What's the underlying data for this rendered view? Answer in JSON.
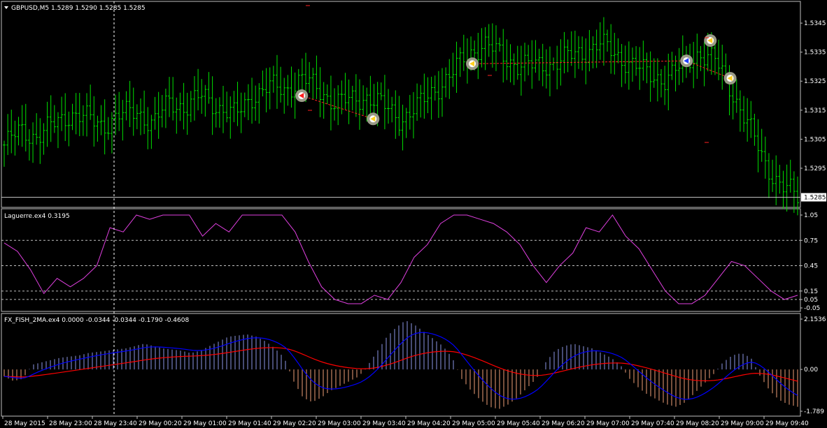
{
  "symbol_header": "GBPUSD,M5  1.5289 1.5290 1.5285 1.5285",
  "laguerre_header": "Laguerre.ex4 0.3195",
  "fisher_header": "FX_FISH_2MA.ex4 0.0000 -0.0344 -0.0344 -0.1790 -0.4608",
  "colors": {
    "background": "#000000",
    "candle": "#00e000",
    "laguerre": "#e040e0",
    "fish_pos": "#8c96e6",
    "fish_neg": "#f0a078",
    "fish_ma_fast": "#0000ff",
    "fish_ma_slow": "#ff0000",
    "grid": "#c0c0c0"
  },
  "chart_data": [
    {
      "type": "ohlc",
      "panel": "price",
      "y_axis_ticks": [
        "1.5345",
        "1.5335",
        "1.5325",
        "1.5315",
        "1.5305",
        "1.5295"
      ],
      "ylim": [
        1.5282,
        1.5352
      ],
      "current_price_label": "1.5285",
      "close_path": [
        1.5303,
        1.5308,
        1.5306,
        1.531,
        1.5314,
        1.5312,
        1.531,
        1.5313,
        1.5315,
        1.531,
        1.5318,
        1.5316,
        1.532,
        1.5316,
        1.5313,
        1.532,
        1.5323,
        1.5322,
        1.5326,
        1.5322,
        1.5318,
        1.5318,
        1.532,
        1.5316,
        1.5312,
        1.5316,
        1.5322,
        1.5327,
        1.5334,
        1.5338,
        1.5334,
        1.5331,
        1.533,
        1.5331,
        1.5333,
        1.5335,
        1.5338,
        1.5334,
        1.5331,
        1.5327,
        1.5326,
        1.533,
        1.5335,
        1.5332,
        1.5322,
        1.531,
        1.5297,
        1.5289,
        1.5285
      ],
      "markers": [
        {
          "price": 1.532,
          "pos": 0.375,
          "color": "#ff2020"
        },
        {
          "price": 1.5312,
          "pos": 0.465,
          "color": "#ffd020"
        },
        {
          "price": 1.5331,
          "pos": 0.59,
          "color": "#ffd020"
        },
        {
          "price": 1.5332,
          "pos": 0.86,
          "color": "#2040ff"
        },
        {
          "price": 1.5339,
          "pos": 0.89,
          "color": "#ffd020"
        },
        {
          "price": 1.5326,
          "pos": 0.915,
          "color": "#ffd020"
        }
      ]
    },
    {
      "type": "line",
      "panel": "laguerre",
      "name": "Laguerre",
      "y_axis_ticks": [
        "1.05",
        "0.75",
        "0.45",
        "0.15",
        "0.05",
        "-0.05"
      ],
      "levels": [
        0.75,
        0.45,
        0.15,
        0.05
      ],
      "ylim": [
        -0.05,
        1.05
      ],
      "values": [
        0.72,
        0.62,
        0.4,
        0.12,
        0.3,
        0.2,
        0.3,
        0.45,
        0.9,
        0.85,
        1.05,
        1.0,
        1.05,
        1.05,
        1.05,
        0.8,
        0.95,
        0.85,
        1.05,
        1.05,
        1.05,
        1.05,
        0.85,
        0.5,
        0.2,
        0.05,
        0.0,
        0.0,
        0.1,
        0.05,
        0.25,
        0.55,
        0.7,
        0.95,
        1.05,
        1.05,
        1.0,
        0.95,
        0.85,
        0.7,
        0.45,
        0.25,
        0.45,
        0.6,
        0.9,
        0.85,
        1.05,
        0.8,
        0.65,
        0.4,
        0.15,
        0.0,
        0.0,
        0.1,
        0.3,
        0.5,
        0.45,
        0.3,
        0.15,
        0.05,
        0.1
      ]
    },
    {
      "type": "bar",
      "panel": "fisher",
      "name": "FX_FISH_2MA",
      "y_axis_ticks": [
        "2.1536",
        "0.00",
        "-1.789"
      ],
      "ylim": [
        -1.789,
        2.1536
      ],
      "values": [
        -0.3,
        -0.5,
        -0.4,
        0.2,
        0.3,
        0.4,
        0.5,
        0.55,
        0.6,
        0.7,
        0.75,
        0.8,
        0.85,
        0.9,
        1.0,
        1.1,
        1.0,
        0.9,
        0.85,
        0.8,
        0.7,
        0.8,
        1.0,
        1.2,
        1.4,
        1.45,
        1.5,
        1.4,
        1.2,
        0.9,
        0.5,
        -0.5,
        -1.2,
        -1.4,
        -1.2,
        -0.9,
        -0.7,
        -0.5,
        -0.3,
        0.2,
        0.8,
        1.4,
        1.8,
        2.1,
        1.9,
        1.6,
        1.3,
        1.0,
        0.5,
        -0.4,
        -0.9,
        -1.3,
        -1.6,
        -1.7,
        -1.5,
        -1.2,
        -0.8,
        -0.4,
        0.3,
        0.8,
        1.0,
        1.1,
        1.0,
        0.9,
        0.7,
        0.5,
        0.2,
        -0.4,
        -0.8,
        -1.1,
        -1.3,
        -1.5,
        -1.6,
        -1.4,
        -1.0,
        -0.6,
        -0.2,
        0.3,
        0.6,
        0.7,
        0.5,
        -0.3,
        -0.9,
        -1.3,
        -1.5,
        -1.6
      ]
    }
  ],
  "x_axis_labels": [
    "28 May 2015",
    "28 May 23:00",
    "28 May 23:40",
    "29 May 00:20",
    "29 May 01:00",
    "29 May 01:40",
    "29 May 02:20",
    "29 May 03:00",
    "29 May 03:40",
    "29 May 04:20",
    "29 May 05:00",
    "29 May 05:40",
    "29 May 06:20",
    "29 May 07:00",
    "29 May 07:40",
    "29 May 08:20",
    "29 May 09:00",
    "29 May 09:40"
  ]
}
